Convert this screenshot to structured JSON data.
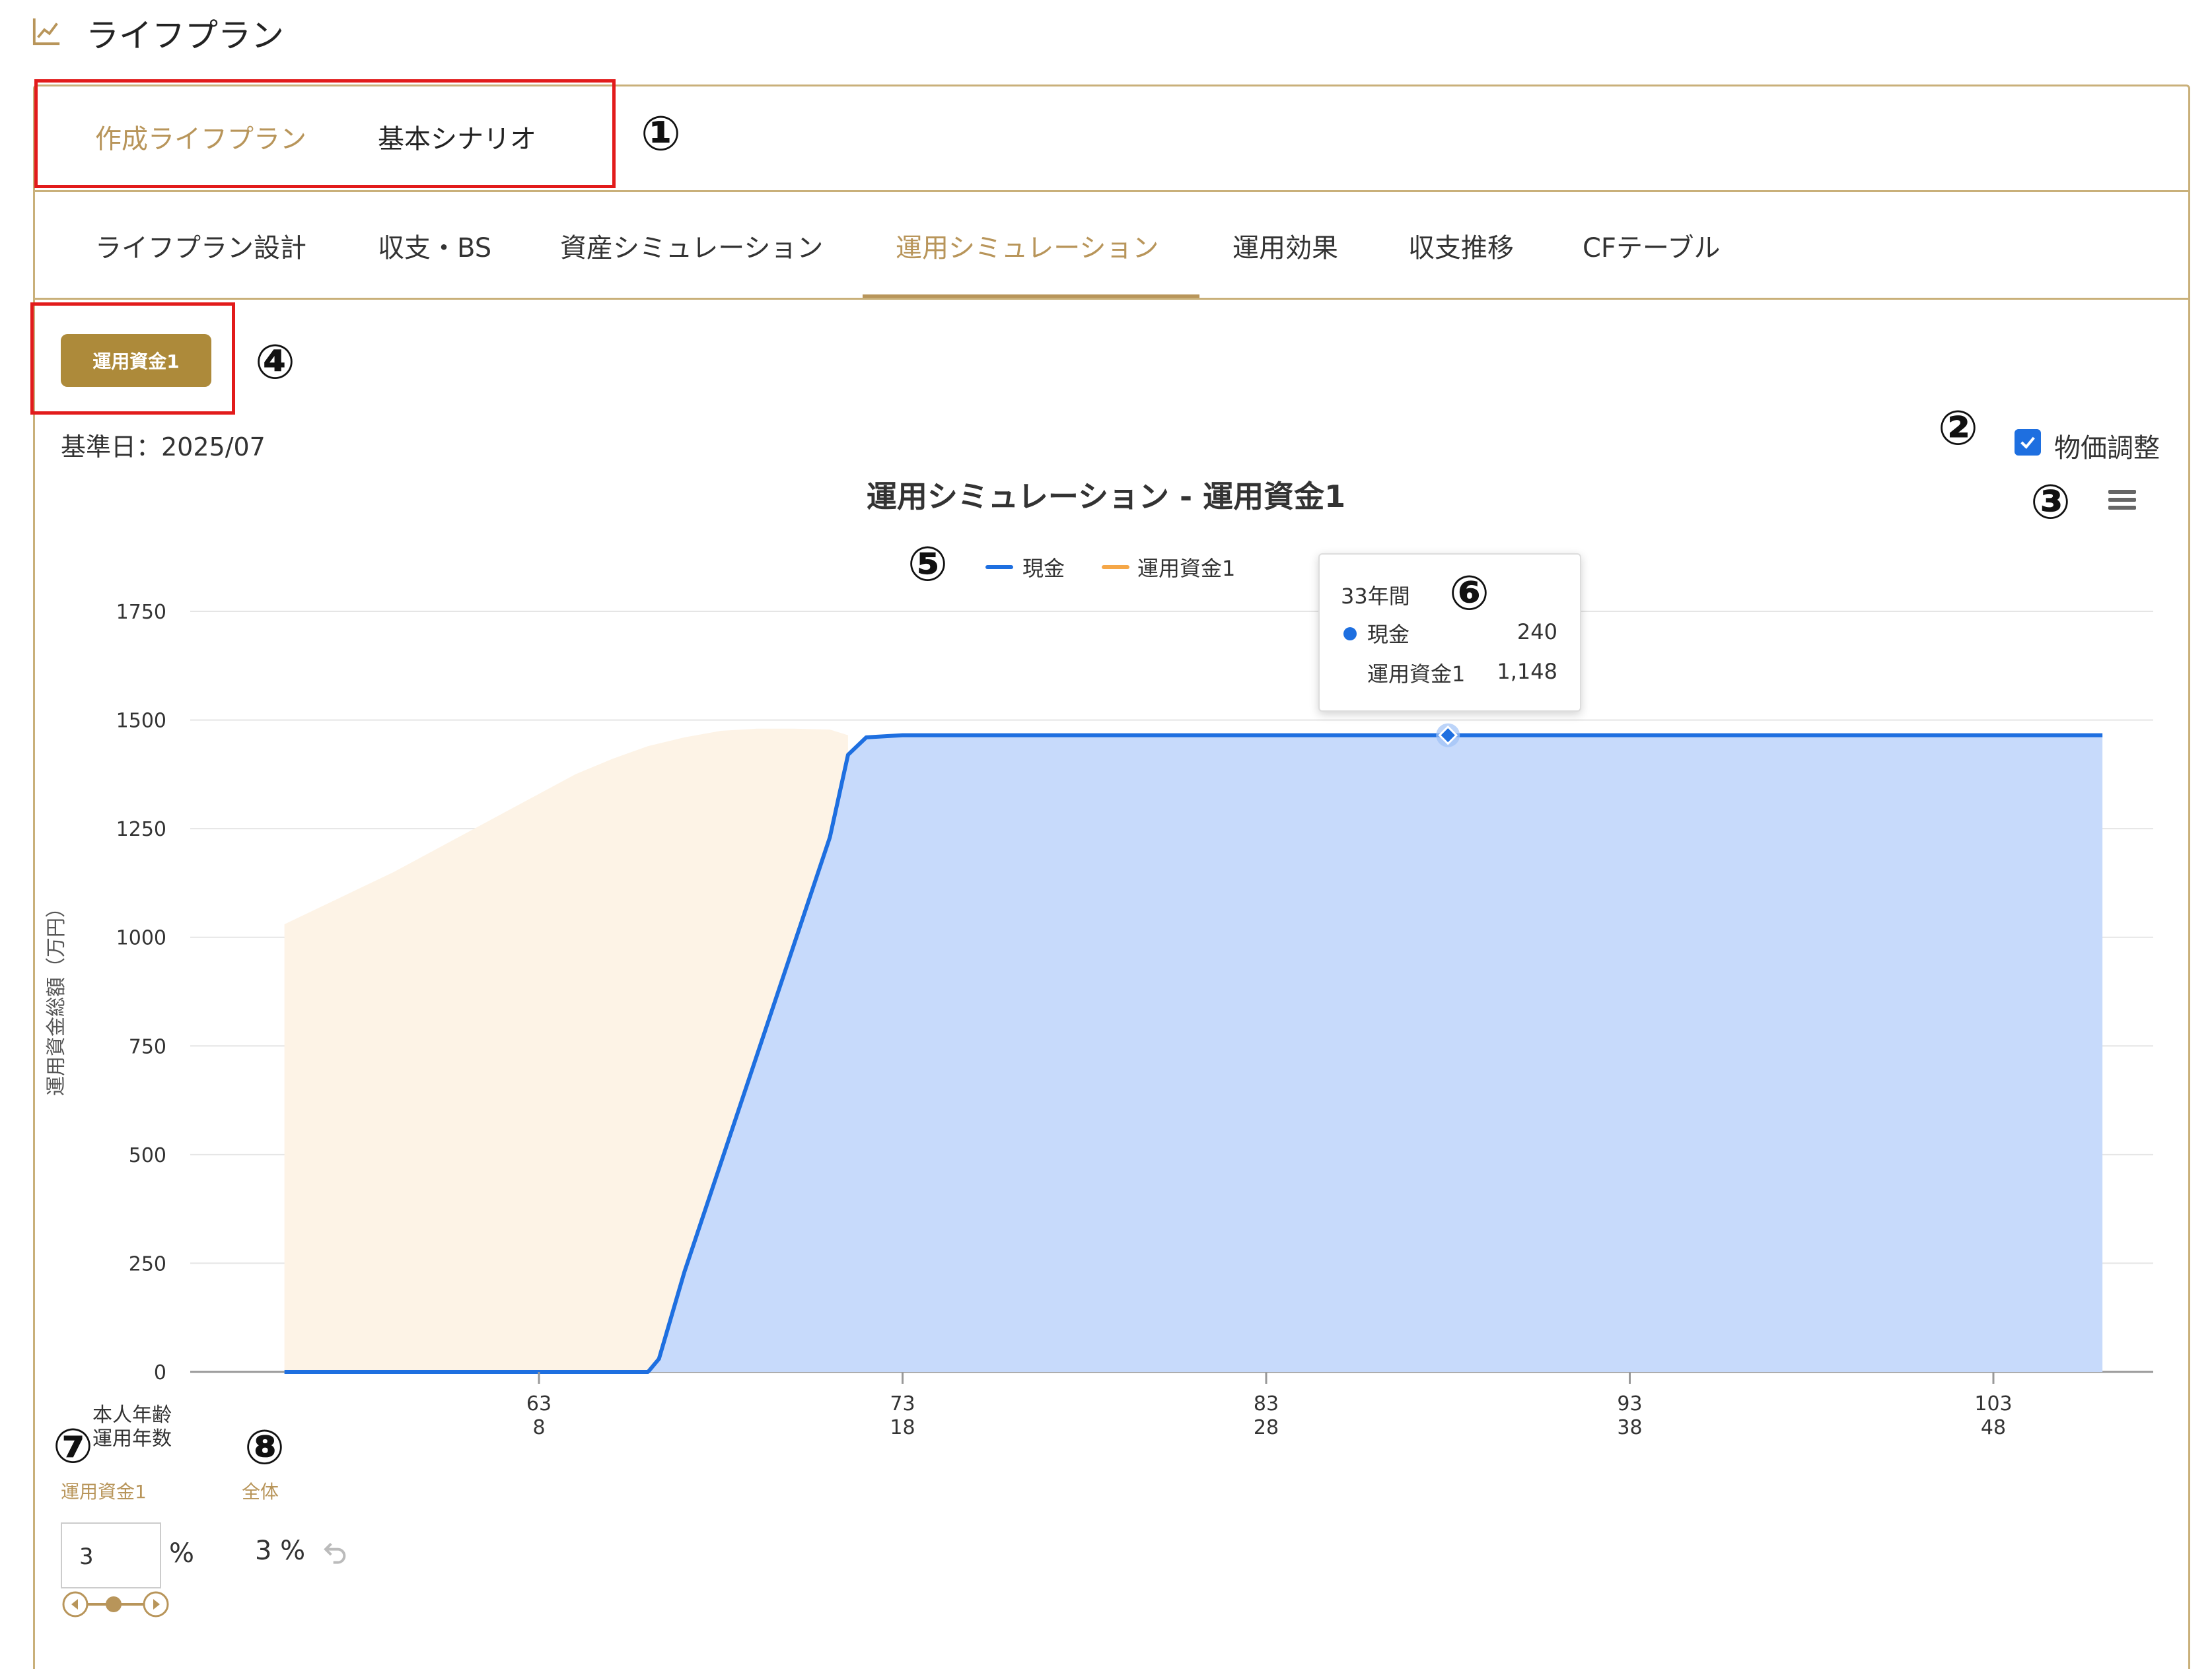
{
  "header": {
    "title": "ライフプラン",
    "icon": "line-chart-icon"
  },
  "plan_tabs": [
    {
      "label": "作成ライフプラン",
      "active": true
    },
    {
      "label": "基本シナリオ",
      "active": false
    }
  ],
  "nav_tabs": [
    {
      "label": "ライフプラン設計"
    },
    {
      "label": "収支・BS"
    },
    {
      "label": "資産シミュレーション"
    },
    {
      "label": "運用シミュレーション",
      "active": true
    },
    {
      "label": "運用効果"
    },
    {
      "label": "収支推移"
    },
    {
      "label": "CFテーブル"
    }
  ],
  "fund_button": {
    "label": "運用資金1"
  },
  "base_date": "基準日：2025/07",
  "inflation": {
    "label": "物価調整",
    "checked": true
  },
  "annotations": [
    "①",
    "②",
    "③",
    "④",
    "⑤",
    "⑥",
    "⑦",
    "⑧"
  ],
  "tooltip": {
    "title": "33年間",
    "rows": [
      {
        "label": "現金",
        "value": "240"
      },
      {
        "label": "運用資金1",
        "value": "1,148"
      }
    ]
  },
  "controls": {
    "fund_label": "運用資金1",
    "overall_label": "全体",
    "rate_value": "3",
    "pct_sign": "%",
    "overall_rate": "3 %"
  },
  "colors": {
    "accent": "#b8955a",
    "cash": "#1e6fe0",
    "fund": "#f5a748",
    "cash_fill": "#c7dafb",
    "fund_fill": "#fdf3e6"
  },
  "chart_data": {
    "type": "area",
    "title": "運用シミュレーション - 運用資金1",
    "ylabel": "運用資金総額（万円）",
    "ylim": [
      0,
      1750
    ],
    "yticks": [
      0,
      250,
      500,
      750,
      1000,
      1250,
      1500,
      1750
    ],
    "x_axis_row_labels": [
      "本人年齢",
      "運用年数"
    ],
    "xticks": [
      {
        "age": "63",
        "years": "8"
      },
      {
        "age": "73",
        "years": "18"
      },
      {
        "age": "83",
        "years": "28"
      },
      {
        "age": "93",
        "years": "38"
      },
      {
        "age": "103",
        "years": "48"
      }
    ],
    "xlim": [
      1,
      50
    ],
    "legend_position": "top-center",
    "series": [
      {
        "name": "現金",
        "points": [
          [
            1,
            0
          ],
          [
            2,
            0
          ],
          [
            3,
            0
          ],
          [
            4,
            0
          ],
          [
            5,
            0
          ],
          [
            6,
            0
          ],
          [
            7,
            0
          ],
          [
            8,
            0
          ],
          [
            9,
            0
          ],
          [
            10,
            0
          ],
          [
            11,
            0
          ],
          [
            11.3,
            30
          ],
          [
            12,
            230
          ],
          [
            14,
            730
          ],
          [
            15,
            980
          ],
          [
            16,
            1230
          ],
          [
            16.5,
            1420
          ],
          [
            17,
            1460
          ],
          [
            18,
            1465
          ],
          [
            28,
            1465
          ],
          [
            33,
            1465
          ],
          [
            38,
            1465
          ],
          [
            48,
            1465
          ],
          [
            51,
            1465
          ]
        ]
      },
      {
        "name": "運用資金1",
        "points": [
          [
            1,
            1030
          ],
          [
            2,
            1070
          ],
          [
            3,
            1110
          ],
          [
            4,
            1150
          ],
          [
            5,
            1195
          ],
          [
            6,
            1240
          ],
          [
            7,
            1285
          ],
          [
            8,
            1330
          ],
          [
            9,
            1375
          ],
          [
            10,
            1410
          ],
          [
            11,
            1440
          ],
          [
            12,
            1460
          ],
          [
            13,
            1475
          ],
          [
            14,
            1480
          ],
          [
            15,
            1480
          ],
          [
            16,
            1478
          ],
          [
            16.5,
            1465
          ]
        ]
      }
    ]
  }
}
